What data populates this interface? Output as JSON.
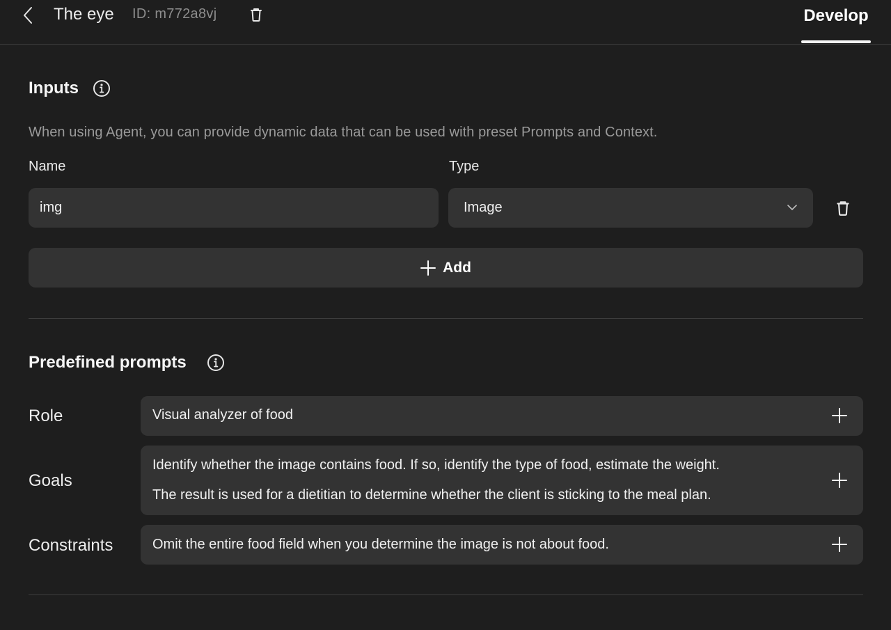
{
  "header": {
    "title": "The eye",
    "id_text": "ID: m772a8vj",
    "tab_develop": "Develop"
  },
  "inputs": {
    "title": "Inputs",
    "description": "When using Agent, you can provide dynamic data that can be used with preset Prompts and Context.",
    "name_label": "Name",
    "type_label": "Type",
    "rows": [
      {
        "name": "img",
        "type": "Image"
      }
    ],
    "add_label": "Add"
  },
  "prompts": {
    "title": "Predefined prompts",
    "role_label": "Role",
    "role_value": "Visual analyzer of food",
    "goals_label": "Goals",
    "goals_line1": "Identify whether the image contains food. If so, identify the type of food, estimate the weight.",
    "goals_line2": "The result is used for a dietitian to determine whether the client is sticking to the meal plan.",
    "constraints_label": "Constraints",
    "constraints_value": "Omit the entire food field when you determine the image is not about food."
  },
  "colors": {
    "background": "#1e1e1e",
    "field": "#333333",
    "divider": "#3d3d3d",
    "muted_text": "#9a9a9a"
  },
  "icons": [
    "chevron-left-icon",
    "trash-icon",
    "info-icon",
    "chevron-down-icon",
    "plus-icon"
  ]
}
